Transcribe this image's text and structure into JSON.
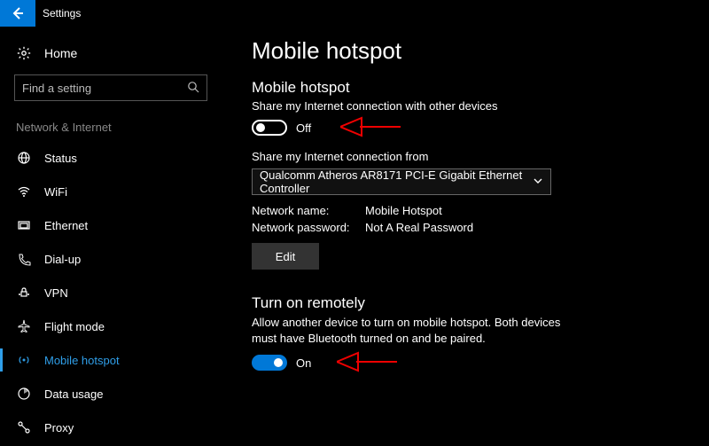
{
  "titlebar": {
    "title": "Settings"
  },
  "sidebar": {
    "home_label": "Home",
    "search_placeholder": "Find a setting",
    "section_label": "Network & Internet",
    "items": [
      {
        "label": "Status"
      },
      {
        "label": "WiFi"
      },
      {
        "label": "Ethernet"
      },
      {
        "label": "Dial-up"
      },
      {
        "label": "VPN"
      },
      {
        "label": "Flight mode"
      },
      {
        "label": "Mobile hotspot"
      },
      {
        "label": "Data usage"
      },
      {
        "label": "Proxy"
      }
    ]
  },
  "main": {
    "page_title": "Mobile hotspot",
    "hotspot": {
      "heading": "Mobile hotspot",
      "desc": "Share my Internet connection with other devices",
      "toggle_state": "Off"
    },
    "share_from": {
      "label": "Share my Internet connection from",
      "selected": "Qualcomm Atheros AR8171 PCI-E Gigabit Ethernet Controller"
    },
    "network": {
      "name_label": "Network name:",
      "name_value": "Mobile Hotspot",
      "password_label": "Network password:",
      "password_value": "Not A Real Password",
      "edit_label": "Edit"
    },
    "remote": {
      "heading": "Turn on remotely",
      "desc": "Allow another device to turn on mobile hotspot. Both devices must have Bluetooth turned on and be paired.",
      "toggle_state": "On"
    }
  }
}
